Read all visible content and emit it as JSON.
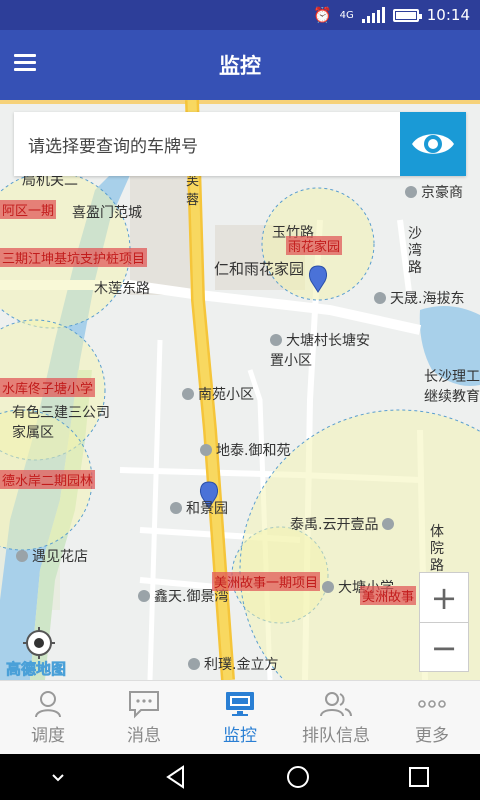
{
  "status_bar": {
    "time": "10:14",
    "network": "4G"
  },
  "app_bar": {
    "title": "监控"
  },
  "search": {
    "placeholder": "请选择要查询的车牌号"
  },
  "map": {
    "logo": "高德地图",
    "labels": [
      {
        "text": "京豪商",
        "type": "poi"
      },
      {
        "text": "喜盈门范城",
        "type": "poi"
      },
      {
        "text": "玉竹路",
        "type": "road"
      },
      {
        "text": "仁和雨花家园",
        "type": "place"
      },
      {
        "text": "沙湾路",
        "type": "road"
      },
      {
        "text": "木莲东路",
        "type": "road"
      },
      {
        "text": "天晟.海拔东",
        "type": "poi"
      },
      {
        "text": "大塘村长塘安置小区",
        "type": "poi"
      },
      {
        "text": "长沙理工继续教育",
        "type": "place"
      },
      {
        "text": "南苑小区",
        "type": "poi"
      },
      {
        "text": "有色三建三公司家属区",
        "type": "place"
      },
      {
        "text": "地泰.御和苑",
        "type": "poi"
      },
      {
        "text": "和景园",
        "type": "poi"
      },
      {
        "text": "泰禹.云开壹品",
        "type": "poi"
      },
      {
        "text": "体院路",
        "type": "road"
      },
      {
        "text": "遇见花店",
        "type": "poi"
      },
      {
        "text": "鑫天.御景湾",
        "type": "poi"
      },
      {
        "text": "大塘小学",
        "type": "poi"
      },
      {
        "text": "利璞.金立方",
        "type": "poi"
      },
      {
        "text": "局机关二",
        "type": "place"
      },
      {
        "text": "芙蓉",
        "type": "road"
      }
    ],
    "sites": [
      "雨花家园",
      "阿区一期",
      "三期江坤基坑支护桩项目",
      "水库佟子塘小学",
      "德水岸二期园林",
      "美洲故事一期项目",
      "美洲故事"
    ],
    "zoom_in": "+",
    "zoom_out": "−"
  },
  "bottom_nav": [
    {
      "label": "调度",
      "icon": "person-icon"
    },
    {
      "label": "消息",
      "icon": "chat-icon"
    },
    {
      "label": "监控",
      "icon": "monitor-icon",
      "active": true
    },
    {
      "label": "排队信息",
      "icon": "group-icon"
    },
    {
      "label": "更多",
      "icon": "more-icon"
    }
  ]
}
